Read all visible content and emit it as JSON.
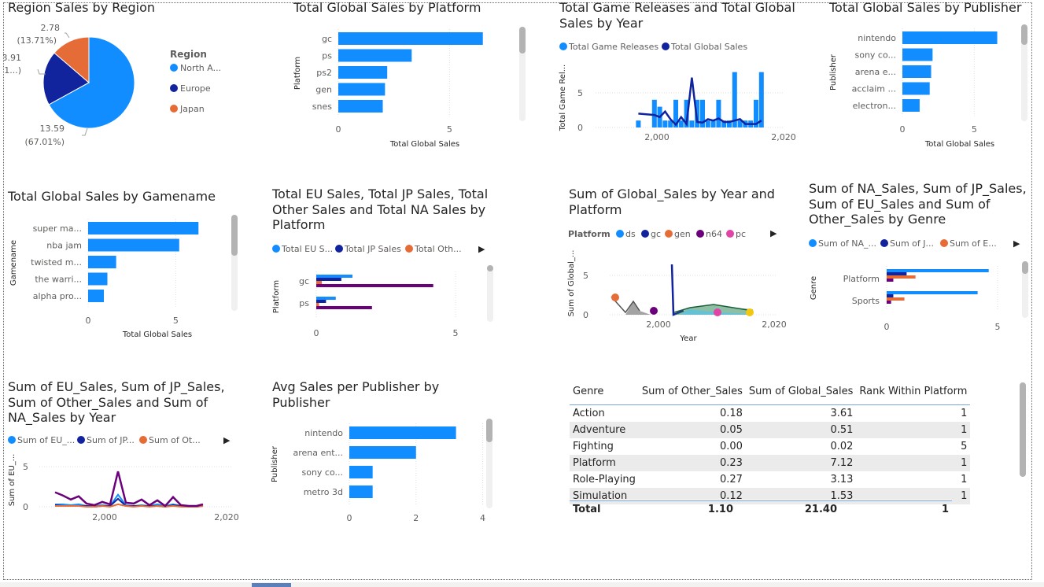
{
  "colors": {
    "blue": "#118dff",
    "navy": "#12239e",
    "orange": "#e66c37",
    "purple": "#6b007b",
    "pink": "#e044a7",
    "grid": "#e1dfdd"
  },
  "region_pie": {
    "title": "Region Sales by Region",
    "legend_title": "Region",
    "slices": [
      {
        "label": "North A...",
        "value": 13.59,
        "pct": "(67.01%)",
        "color": "#118dff"
      },
      {
        "label": "Europe",
        "value": 3.91,
        "pct": "(1...)",
        "color": "#12239e"
      },
      {
        "label": "Japan",
        "value": 2.78,
        "pct": "(13.71%)",
        "color": "#e66c37"
      }
    ],
    "value_labels": [
      "13.59",
      "(67.01%)",
      "3.91",
      "(1...)",
      "2.78",
      "(13.71%)"
    ]
  },
  "platform_bar": {
    "title": "Total Global Sales by Platform",
    "ylabel": "Platform",
    "xlabel": "Total Global Sales",
    "categories": [
      "gc",
      "ps",
      "ps2",
      "gen",
      "snes"
    ],
    "values": [
      6.5,
      3.3,
      2.2,
      2.1,
      2.0
    ],
    "ticks": [
      "0",
      "5"
    ],
    "xmax": 7.5
  },
  "releases_combo": {
    "title": "Total Game Releases and Total Global Sales by Year",
    "legend": [
      "Total Game Releases",
      "Total Global Sales"
    ],
    "ylabel": "Total Game Rel...",
    "yticks": [
      "0",
      "5"
    ],
    "xticks": [
      "2,000",
      "2,020"
    ],
    "years": [
      1993,
      1996,
      1997,
      1998,
      1999,
      2000,
      2001,
      2002,
      2003,
      2004,
      2005,
      2006,
      2007,
      2008,
      2009,
      2010,
      2011,
      2012,
      2013,
      2014,
      2015,
      2016
    ],
    "releases": [
      1,
      4,
      3,
      1,
      1,
      4,
      1,
      4,
      1,
      4,
      4,
      1,
      1,
      4,
      1,
      1,
      8,
      1,
      1,
      1,
      4,
      8
    ],
    "sales": [
      2,
      1.8,
      1.5,
      2.3,
      1.2,
      0.4,
      1.5,
      0.5,
      7.2,
      0.8,
      0.7,
      1.2,
      1.0,
      1.3,
      0.8,
      0.8,
      1.0,
      1.2,
      0.5,
      0.5,
      0.5,
      1.0
    ]
  },
  "publisher_bar": {
    "title": "Total Global Sales by Publisher",
    "ylabel": "Publisher",
    "xlabel": "Total Global Sales",
    "categories": [
      "nintendo",
      "sony co...",
      "arena e...",
      "acclaim ...",
      "electron..."
    ],
    "values": [
      6.6,
      2.1,
      2.0,
      1.9,
      1.2
    ],
    "ticks": [
      "0",
      "5"
    ],
    "xmax": 7.5
  },
  "gamename_bar": {
    "title": "Total Global Sales by Gamename",
    "ylabel": "Gamename",
    "xlabel": "Total Global Sales",
    "categories": [
      "super ma...",
      "nba jam",
      "twisted m...",
      "the warri...",
      "alpha pro..."
    ],
    "values": [
      6.3,
      5.2,
      1.6,
      1.1,
      0.9
    ],
    "ticks": [
      "0",
      "5"
    ],
    "xmax": 7.5
  },
  "region_platform_bar": {
    "title": "Total EU Sales, Total JP Sales, Total Other Sales and Total NA Sales by Platform",
    "legend": [
      "Total EU S...",
      "Total JP Sales",
      "Total Oth..."
    ],
    "ylabel": "Platform",
    "categories": [
      "gc",
      "ps"
    ],
    "series": [
      {
        "name": "Total EU S...",
        "values": [
          1.3,
          0.7
        ]
      },
      {
        "name": "Total JP Sales",
        "values": [
          0.9,
          0.35
        ]
      },
      {
        "name": "Total Oth...",
        "values": [
          0.2,
          0.1
        ]
      },
      {
        "name": "Total NA Sales",
        "values": [
          4.2,
          2.0
        ]
      }
    ],
    "ticks": [
      "0",
      "5"
    ],
    "xmax": 5
  },
  "year_platform_area": {
    "title": "Sum of Global_Sales by Year and Platform",
    "legend_title": "Platform",
    "legend": [
      "ds",
      "gc",
      "gen",
      "n64",
      "pc"
    ],
    "ylabel": "Sum of Global_...",
    "xlabel": "Year",
    "yticks": [
      "0",
      "5"
    ],
    "xticks": [
      "2,000",
      "2,020"
    ]
  },
  "genre_bar": {
    "title": "Sum of NA_Sales, Sum of JP_Sales, Sum of EU_Sales and Sum of Other_Sales by Genre",
    "legend": [
      "Sum of NA_...",
      "Sum of J...",
      "Sum of E..."
    ],
    "ylabel": "Genre",
    "categories": [
      "Platform",
      "Sports"
    ],
    "series": [
      {
        "name": "Sum of NA_...",
        "values": [
          4.6,
          4.1
        ]
      },
      {
        "name": "Sum of J...",
        "values": [
          0.9,
          0.3
        ]
      },
      {
        "name": "Sum of E...",
        "values": [
          1.3,
          0.8
        ]
      },
      {
        "name": "Sum of Other_Sales",
        "values": [
          0.3,
          0.2
        ]
      }
    ],
    "ticks": [
      "0",
      "5"
    ],
    "xmax": 5
  },
  "year_lines": {
    "title": "Sum of EU_Sales, Sum of JP_Sales, Sum of Other_Sales and Sum of NA_Sales by Year",
    "legend": [
      "Sum of EU_...",
      "Sum of JP...",
      "Sum of Ot..."
    ],
    "ylabel": "Sum of EU_...",
    "yticks": [
      "0",
      "5"
    ],
    "xticks": [
      "2,000",
      "2,020"
    ]
  },
  "avg_publisher_bar": {
    "title": "Avg Sales per Publisher by Publisher",
    "ylabel": "Publisher",
    "categories": [
      "nintendo",
      "arena ent...",
      "sony co...",
      "metro 3d"
    ],
    "values": [
      3.2,
      2.0,
      0.7,
      0.7
    ],
    "ticks": [
      "0",
      "2",
      "4"
    ],
    "xmax": 4.2
  },
  "genre_table": {
    "headers": [
      "Genre",
      "Sum of Other_Sales",
      "Sum of Global_Sales",
      "Rank Within Platform"
    ],
    "rows": [
      [
        "Action",
        "0.18",
        "3.61",
        "1"
      ],
      [
        "Adventure",
        "0.05",
        "0.51",
        "1"
      ],
      [
        "Fighting",
        "0.00",
        "0.02",
        "5"
      ],
      [
        "Platform",
        "0.23",
        "7.12",
        "1"
      ],
      [
        "Role-Playing",
        "0.27",
        "3.13",
        "1"
      ],
      [
        "Simulation",
        "0.12",
        "1.53",
        "1"
      ]
    ],
    "total": [
      "Total",
      "1.10",
      "21.40",
      "1"
    ]
  }
}
